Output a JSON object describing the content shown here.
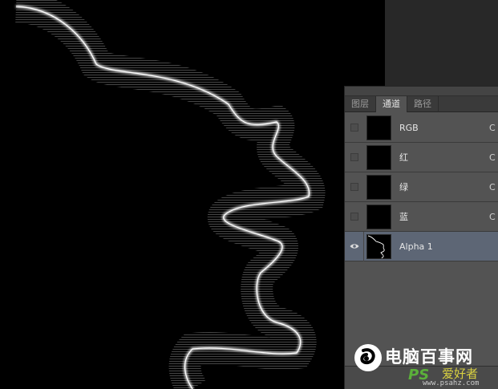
{
  "panel": {
    "tabs": [
      {
        "label": "图层",
        "active": false
      },
      {
        "label": "通道",
        "active": true
      },
      {
        "label": "路径",
        "active": false
      }
    ],
    "channels": [
      {
        "label": "RGB",
        "visible": false,
        "selected": false,
        "meta": "C"
      },
      {
        "label": "红",
        "visible": false,
        "selected": false,
        "meta": "C"
      },
      {
        "label": "绿",
        "visible": false,
        "selected": false,
        "meta": "C"
      },
      {
        "label": "蓝",
        "visible": false,
        "selected": false,
        "meta": "C"
      },
      {
        "label": "Alpha 1",
        "visible": true,
        "selected": true,
        "meta": ""
      }
    ]
  },
  "watermark": {
    "title": "电脑百事网",
    "ps_mark": "PS",
    "subtitle": "爱好者",
    "url": "www.psahz.com"
  },
  "colors": {
    "canvas": "#000000",
    "panel_bg": "#535353",
    "selected_row": "#5d6675",
    "watermark_green": "#5bb03a",
    "watermark_yellow": "#d8d040"
  }
}
